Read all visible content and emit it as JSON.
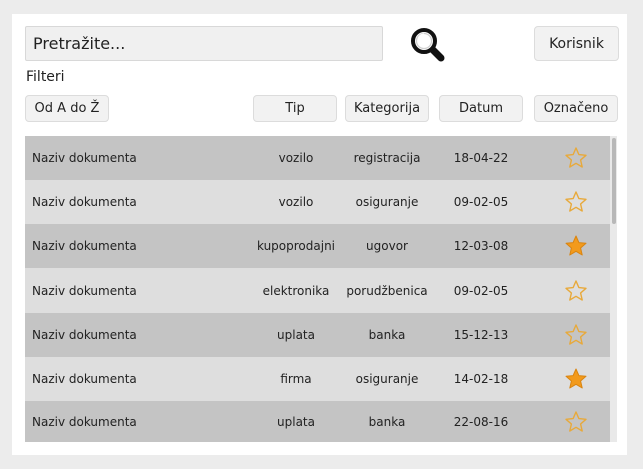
{
  "search": {
    "placeholder": "Pretražite..."
  },
  "header": {
    "user_label": "Korisnik"
  },
  "filters": {
    "label": "Filteri",
    "sort_label": "Od A do Ž",
    "columns": [
      "Tip",
      "Kategorija",
      "Datum",
      "Označeno"
    ]
  },
  "colors": {
    "star_filled": "#f29a1c",
    "star_outline": "#e8a93a",
    "row_dark": "#c4c4c4",
    "row_light": "#dedede"
  },
  "rows": [
    {
      "name": "Naziv dokumenta",
      "tip": "vozilo",
      "kategorija": "registracija",
      "datum": "18-04-22",
      "starred": false
    },
    {
      "name": "Naziv dokumenta",
      "tip": "vozilo",
      "kategorija": "osiguranje",
      "datum": "09-02-05",
      "starred": false
    },
    {
      "name": "Naziv dokumenta",
      "tip": "kupoprodajni",
      "kategorija": "ugovor",
      "datum": "12-03-08",
      "starred": true
    },
    {
      "name": "Naziv dokumenta",
      "tip": "elektronika",
      "kategorija": "porudžbenica",
      "datum": "09-02-05",
      "starred": false
    },
    {
      "name": "Naziv dokumenta",
      "tip": "uplata",
      "kategorija": "banka",
      "datum": "15-12-13",
      "starred": false
    },
    {
      "name": "Naziv dokumenta",
      "tip": "firma",
      "kategorija": "osiguranje",
      "datum": "14-02-18",
      "starred": true
    },
    {
      "name": "Naziv dokumenta",
      "tip": "uplata",
      "kategorija": "banka",
      "datum": "22-08-16",
      "starred": false
    }
  ]
}
